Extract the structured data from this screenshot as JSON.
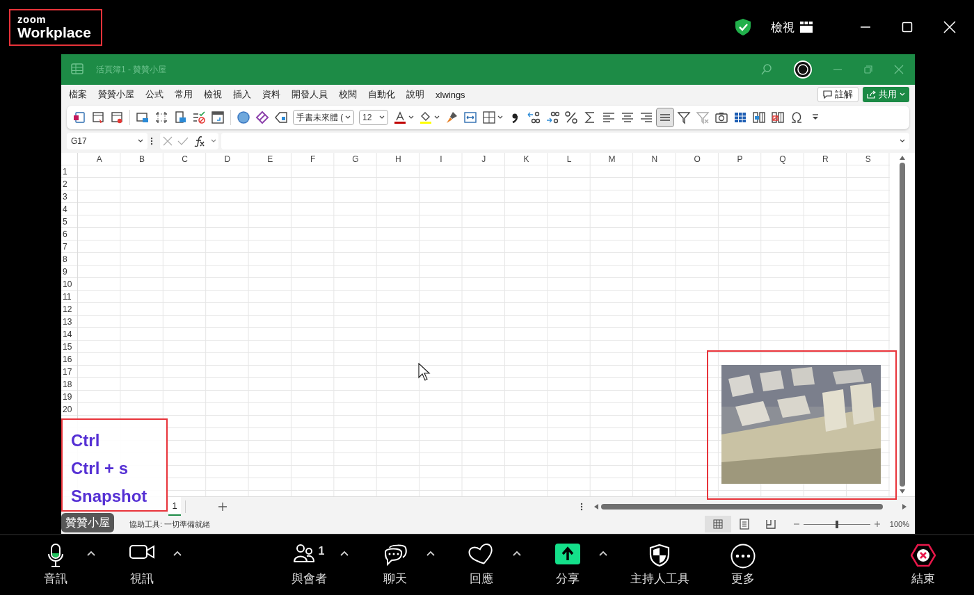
{
  "top_bar": {
    "logo_line_1": "zoom",
    "logo_line_2": "Workplace",
    "view_button": "檢視"
  },
  "excel": {
    "title": "活頁簿1  -  贊贊小屋",
    "menu": [
      "檔案",
      "贊贊小屋",
      "公式",
      "常用",
      "檢視",
      "插入",
      "資料",
      "開發人員",
      "校閱",
      "自動化",
      "說明",
      "xlwings"
    ],
    "comment_button": "註解",
    "share_button": "共用",
    "ribbon": {
      "font_name": "手書未來體 (",
      "font_size": "12",
      "justify_selected": true
    },
    "name_box": "G17",
    "columns": [
      "A",
      "B",
      "C",
      "D",
      "E",
      "F",
      "G",
      "H",
      "I",
      "J",
      "K",
      "L",
      "M",
      "N",
      "O",
      "P",
      "Q",
      "R",
      "S"
    ],
    "rows": [
      "1",
      "2",
      "3",
      "4",
      "5",
      "6",
      "7",
      "8",
      "9",
      "10",
      "11",
      "12",
      "13",
      "14",
      "15",
      "16",
      "17",
      "18",
      "19",
      "20"
    ],
    "sheet_tabs": [
      {
        "label": "1",
        "selected": true
      }
    ],
    "status": "協助工具: 一切準備就緒",
    "view_modes": [
      {
        "kind": "normal",
        "selected": true
      },
      {
        "kind": "page_layout",
        "selected": false
      },
      {
        "kind": "page_break",
        "selected": false
      }
    ],
    "zoom": {
      "level": 0.5,
      "reading": "100%"
    }
  },
  "annotation": [
    "Ctrl",
    "Ctrl + s",
    "Snapshot"
  ],
  "participant_name": "贊贊小屋",
  "controls": [
    {
      "kind": "audio",
      "label": "音訊",
      "menu_caret": true
    },
    {
      "kind": "video",
      "label": "視訊",
      "menu_caret": true
    },
    {
      "kind": "participants",
      "label": "與會者",
      "count": "1",
      "menu_caret": true
    },
    {
      "kind": "chat",
      "label": "聊天",
      "menu_caret": true
    },
    {
      "kind": "reactions",
      "label": "回應",
      "menu_caret": true
    },
    {
      "kind": "share",
      "label": "分享",
      "menu_caret": true
    },
    {
      "kind": "host_tools",
      "label": "主持人工具",
      "menu_caret": false
    },
    {
      "kind": "more",
      "label": "更多",
      "menu_caret": false
    },
    {
      "kind": "end",
      "label": "結束",
      "menu_caret": false
    }
  ]
}
